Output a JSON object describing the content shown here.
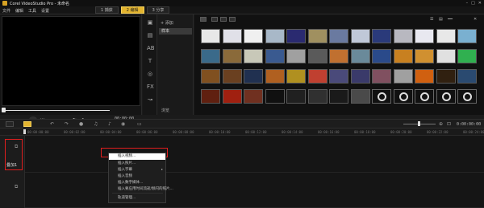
{
  "window": {
    "title": "Corel VideoStudio Pro - 未命名",
    "controls": [
      "–",
      "□",
      "✕"
    ]
  },
  "menubar": {
    "menus": [
      "文件",
      "编辑",
      "工具",
      "设置"
    ],
    "steps": [
      {
        "label": "1 捕获",
        "active": false
      },
      {
        "label": "2 编辑",
        "active": true
      },
      {
        "label": "3 分享",
        "active": false
      }
    ]
  },
  "preview": {
    "timecode": "00:00:00"
  },
  "library": {
    "add_label": "+ 添加",
    "selected_folder": "样本",
    "browse_label": "浏览",
    "sidebar_icons": [
      "media-icon",
      "instant-project-icon",
      "transition-icon",
      "title-icon",
      "graphic-icon",
      "filter-icon",
      "path-icon"
    ],
    "thumbnail_colors": [
      [
        "#e8e8e8",
        "#e0e0e8",
        "#f0f0f0",
        "#a8b8c8",
        "#2a2a70",
        "#a09060",
        "#6a7aa0",
        "#c0c8d8",
        "#2a3a7a",
        "#b8b8c0",
        "#e8e8f0",
        "#e8e8e8",
        "#7ab0d0"
      ],
      [
        "#3a6a8a",
        "#8a6a3a",
        "#c8c8b8",
        "#3a5a90",
        "#a0a0a0",
        "#5a5a5a",
        "#c07030",
        "#6a8a9a",
        "#2a4a8a",
        "#c88020",
        "#d09030",
        "#e0e0e0",
        "#30b050"
      ],
      [
        "#805020",
        "#6a4020",
        "#203050",
        "#b06020",
        "#b09020",
        "#c04030",
        "#4a4a7a",
        "#3a3a6a",
        "#805060",
        "#a0a0a0",
        "#d06010",
        "#302010",
        "#2a4a70"
      ],
      [
        "#602010",
        "#a02010",
        "#703020",
        "#101010",
        "#202020",
        "#303030",
        "#1a1a1a",
        "#4a4a4a",
        "#1a1a1a",
        "#2a2a2a",
        "#101010",
        "#101010",
        "#101010"
      ]
    ]
  },
  "timeline": {
    "timecode": "0:00:00:00",
    "ruler_ticks": [
      "00:00:00:00",
      "00:00:02:00",
      "00:00:04:00",
      "00:00:06:00",
      "00:00:08:00",
      "00:00:10:00",
      "00:00:12:00",
      "00:00:14:00",
      "00:00:16:00",
      "00:00:18:00",
      "00:00:20:00",
      "00:00:22:00",
      "00:00:24:00"
    ],
    "overlay_track_label": "叠加1"
  },
  "context_menu": {
    "items": [
      {
        "label": "插入视频...",
        "highlighted": true
      },
      {
        "label": "插入照片...",
        "highlighted": false
      },
      {
        "label": "插入字幕",
        "highlighted": false,
        "submenu": true
      },
      {
        "label": "插入音频",
        "highlighted": false
      },
      {
        "label": "插入数字媒体...",
        "highlighted": false
      },
      {
        "label": "插入要应用时间流逝/频闪的照片...",
        "highlighted": false
      },
      {
        "label": "轨道管理...",
        "highlighted": false
      }
    ]
  }
}
